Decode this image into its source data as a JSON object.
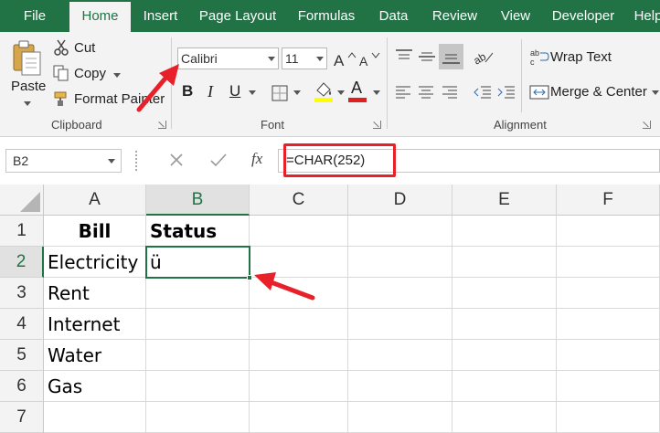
{
  "tabs": [
    "File",
    "Home",
    "Insert",
    "Page Layout",
    "Formulas",
    "Data",
    "Review",
    "View",
    "Developer",
    "Help"
  ],
  "active_tab": "Home",
  "clipboard": {
    "paste": "Paste",
    "cut": "Cut",
    "copy": "Copy",
    "format_painter": "Format Painter",
    "group_label": "Clipboard"
  },
  "font": {
    "name": "Calibri",
    "size": "11",
    "bold": "B",
    "italic": "I",
    "underline": "U",
    "font_color_letter": "A",
    "group_label": "Font"
  },
  "alignment": {
    "wrap_text": "Wrap Text",
    "merge_center": "Merge & Center",
    "group_label": "Alignment"
  },
  "formula_bar": {
    "name_box": "B2",
    "fx": "fx",
    "formula": "=CHAR(252)"
  },
  "colors": {
    "excel_green": "#217346",
    "annotation_red": "#e8202a"
  },
  "sheet": {
    "columns": [
      "A",
      "B",
      "C",
      "D",
      "E",
      "F"
    ],
    "selected_column": "B",
    "rows": [
      "1",
      "2",
      "3",
      "4",
      "5",
      "6",
      "7"
    ],
    "selected_row": "2",
    "cells": {
      "A1": "Bill",
      "B1": "Status",
      "A2": "Electricity",
      "B2": "ü",
      "A3": "Rent",
      "A4": "Internet",
      "A5": "Water",
      "A6": "Gas"
    },
    "active_cell": "B2"
  }
}
